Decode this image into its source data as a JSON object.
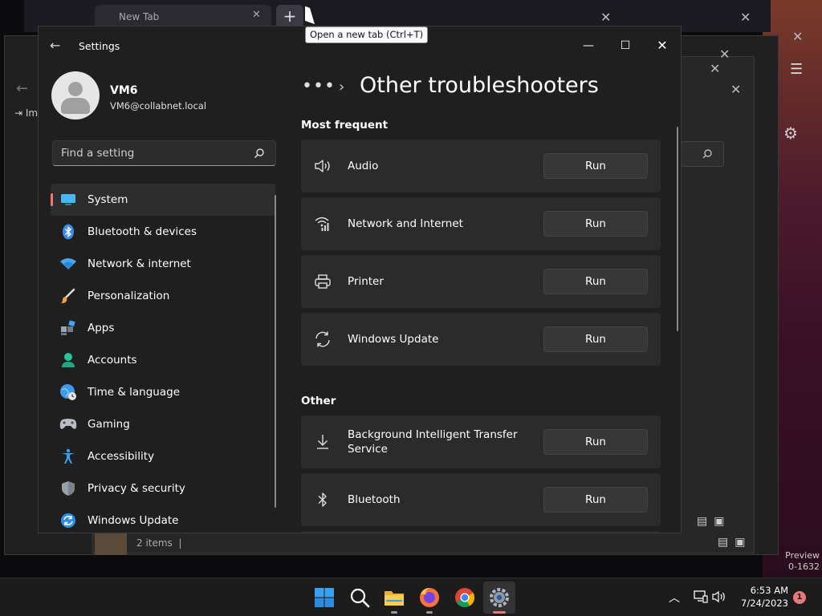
{
  "background": {
    "browser_tab_title": "New Tab",
    "status_items": "2 items",
    "preview_label": "Preview",
    "preview_sub": "0-1632",
    "side_label": "Im"
  },
  "tooltip": "Open a new tab (Ctrl+T)",
  "settings": {
    "app_title": "Settings",
    "user": {
      "name": "VM6",
      "email": "VM6@collabnet.local"
    },
    "search": {
      "placeholder": "Find a setting"
    },
    "nav": [
      {
        "label": "System",
        "icon": "system-icon",
        "active": true
      },
      {
        "label": "Bluetooth & devices",
        "icon": "bluetooth-icon"
      },
      {
        "label": "Network & internet",
        "icon": "wifi-icon"
      },
      {
        "label": "Personalization",
        "icon": "brush-icon"
      },
      {
        "label": "Apps",
        "icon": "apps-icon"
      },
      {
        "label": "Accounts",
        "icon": "accounts-icon"
      },
      {
        "label": "Time & language",
        "icon": "globe-clock-icon"
      },
      {
        "label": "Gaming",
        "icon": "gamepad-icon"
      },
      {
        "label": "Accessibility",
        "icon": "accessibility-icon"
      },
      {
        "label": "Privacy & security",
        "icon": "shield-icon"
      },
      {
        "label": "Windows Update",
        "icon": "windows-update-icon"
      }
    ],
    "breadcrumb_more": "•••",
    "page_title": "Other troubleshooters",
    "sections": {
      "most_frequent": "Most frequent",
      "other": "Other"
    },
    "troubleshooters_frequent": [
      {
        "label": "Audio",
        "icon": "speaker-icon",
        "button": "Run"
      },
      {
        "label": "Network and Internet",
        "icon": "network-icon",
        "button": "Run"
      },
      {
        "label": "Printer",
        "icon": "printer-icon",
        "button": "Run"
      },
      {
        "label": "Windows Update",
        "icon": "refresh-icon",
        "button": "Run"
      }
    ],
    "troubleshooters_other": [
      {
        "label": "Background Intelligent Transfer Service",
        "icon": "download-icon",
        "button": "Run"
      },
      {
        "label": "Bluetooth",
        "icon": "bluetooth-outline-icon",
        "button": "Run"
      }
    ]
  },
  "taskbar": {
    "time": "6:53 AM",
    "date": "7/24/2023",
    "notification_count": "1",
    "accent": "#e8797a"
  }
}
